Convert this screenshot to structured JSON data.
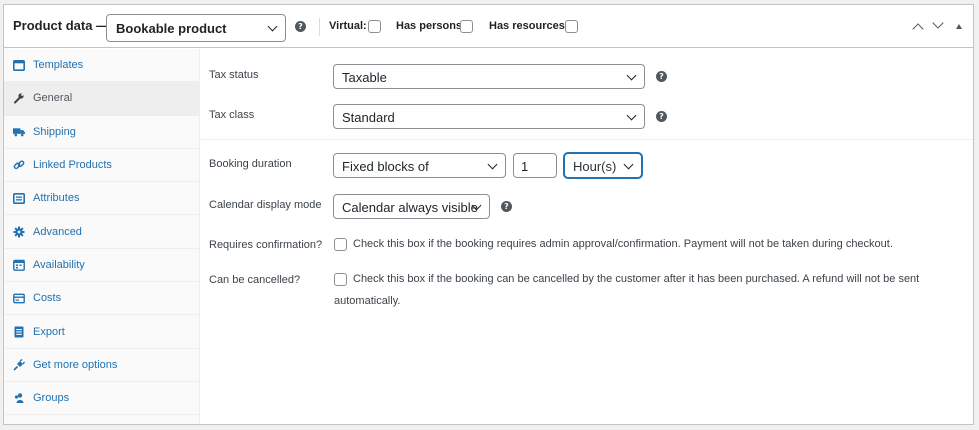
{
  "header": {
    "title": "Product data —",
    "product_type": "Bookable product",
    "virtual_label": "Virtual:",
    "has_persons_label": "Has persons:",
    "has_resources_label": "Has resources:"
  },
  "sidebar": {
    "items": [
      {
        "label": "Templates",
        "icon": "templates-icon"
      },
      {
        "label": "General",
        "icon": "wrench-icon"
      },
      {
        "label": "Shipping",
        "icon": "truck-icon"
      },
      {
        "label": "Linked Products",
        "icon": "link-icon"
      },
      {
        "label": "Attributes",
        "icon": "list-icon"
      },
      {
        "label": "Advanced",
        "icon": "gear-icon"
      },
      {
        "label": "Availability",
        "icon": "calendar-icon"
      },
      {
        "label": "Costs",
        "icon": "cost-icon"
      },
      {
        "label": "Export",
        "icon": "export-icon"
      },
      {
        "label": "Get more options",
        "icon": "plugin-icon"
      },
      {
        "label": "Groups",
        "icon": "groups-icon"
      }
    ],
    "active": "General"
  },
  "general": {
    "tax_status_label": "Tax status",
    "tax_status_value": "Taxable",
    "tax_class_label": "Tax class",
    "tax_class_value": "Standard",
    "booking_duration_label": "Booking duration",
    "booking_duration_type": "Fixed blocks of",
    "booking_duration_value": "1",
    "booking_duration_unit": "Hour(s)",
    "calendar_mode_label": "Calendar display mode",
    "calendar_mode_value": "Calendar always visible",
    "requires_confirmation_label": "Requires confirmation?",
    "requires_confirmation_desc": "Check this box if the booking requires admin approval/confirmation. Payment will not be taken during checkout.",
    "can_be_cancelled_label": "Can be cancelled?",
    "can_be_cancelled_desc_line1": "Check this box if the booking can be cancelled by the customer after it has been purchased. A refund will not be sent",
    "can_be_cancelled_desc_line2": "automatically."
  },
  "colors": {
    "link": "#2271b1",
    "active_tab_bg": "#eeeeee",
    "focus": "#2271b1"
  }
}
